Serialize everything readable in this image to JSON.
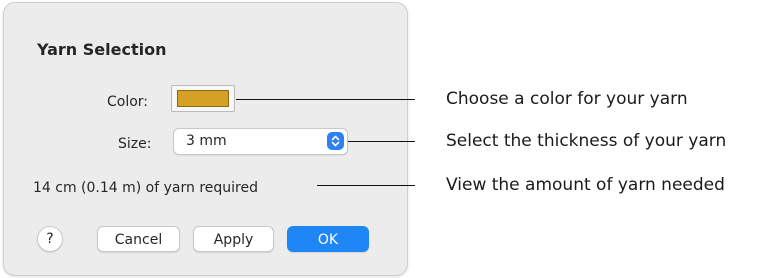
{
  "dialog": {
    "title": "Yarn Selection",
    "color_label": "Color:",
    "color_value": "#d4a126",
    "size_label": "Size:",
    "size_value": "3 mm",
    "requirement_text": "14 cm (0.14 m) of yarn required",
    "help_label": "?",
    "cancel_label": "Cancel",
    "apply_label": "Apply",
    "ok_label": "OK",
    "accent_color": "#1f86f5"
  },
  "callouts": {
    "color": "Choose a color for your yarn",
    "size": "Select the thickness of your yarn",
    "amount": "View the amount of yarn needed"
  }
}
